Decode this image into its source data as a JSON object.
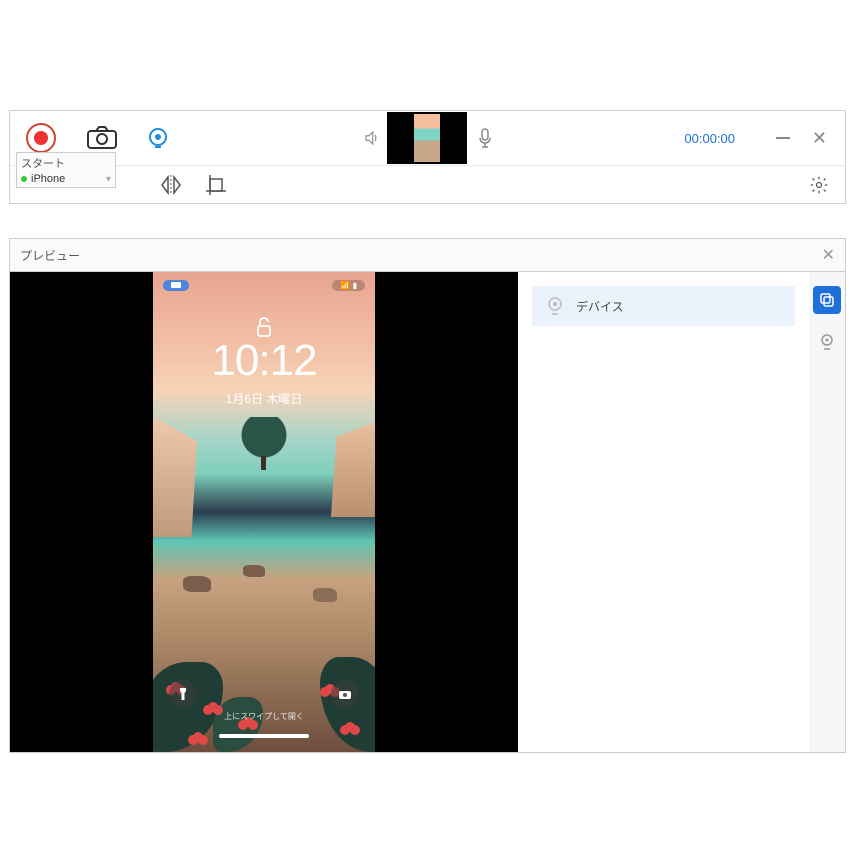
{
  "toolbar": {
    "timer": "00:00:00",
    "start_label": "スタート",
    "device_selected": "iPhone"
  },
  "preview": {
    "title": "プレビュー"
  },
  "phone": {
    "time": "10:12",
    "date": "1月6日 木曜日",
    "swipe_hint": "上にスワイプして開く"
  },
  "sidebar": {
    "device_label": "デバイス"
  }
}
